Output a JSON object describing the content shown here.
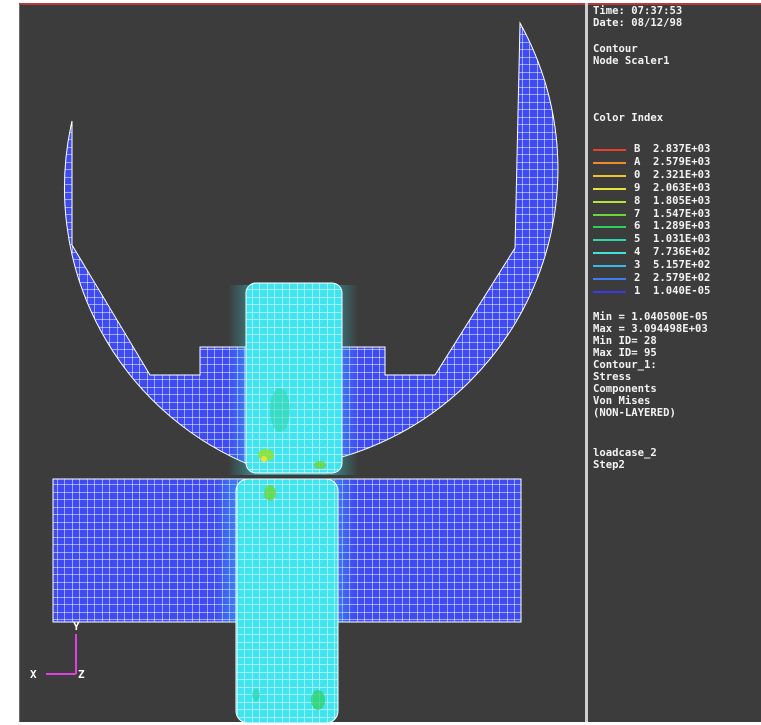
{
  "header": {
    "time": "Time: 07:37:53",
    "date": "Date: 08/12/98"
  },
  "plot": {
    "type_line1": "Contour",
    "type_line2": "Node Scaler1",
    "legend_title": "Color Index",
    "legend": [
      {
        "index": "B",
        "value": "2.837E+03",
        "color": "#e8402a"
      },
      {
        "index": "A",
        "value": "2.579E+03",
        "color": "#f08a2a"
      },
      {
        "index": "0",
        "value": "2.321E+03",
        "color": "#f0c32a"
      },
      {
        "index": "9",
        "value": "2.063E+03",
        "color": "#e8e23a"
      },
      {
        "index": "8",
        "value": "1.805E+03",
        "color": "#b8e23a"
      },
      {
        "index": "7",
        "value": "1.547E+03",
        "color": "#6fd63a"
      },
      {
        "index": "6",
        "value": "1.289E+03",
        "color": "#2fcf5a"
      },
      {
        "index": "5",
        "value": "1.031E+03",
        "color": "#2fd6a6"
      },
      {
        "index": "4",
        "value": "7.736E+02",
        "color": "#3fe2d8"
      },
      {
        "index": "3",
        "value": "5.157E+02",
        "color": "#39b8ee"
      },
      {
        "index": "2",
        "value": "2.579E+02",
        "color": "#3f7cf2"
      },
      {
        "index": "1",
        "value": "1.040E-05",
        "color": "#3a3ae8"
      }
    ],
    "min": "Min = 1.040500E-05",
    "max": "Max = 3.094498E+03",
    "min_id": "Min ID= 28",
    "max_id": "Max ID= 95",
    "contour_lines": [
      "Contour_1:",
      "Stress",
      "Components",
      "Von Mises",
      "(NON-LAYERED)"
    ],
    "loadcase_lines": [
      "loadcase_2",
      "Step2"
    ]
  },
  "axes": {
    "x_label": "X",
    "y_label": "Y",
    "z_label": "Z"
  },
  "colors": {
    "background": "#3c3c3c",
    "mesh_blue": "#3f4bf2",
    "mesh_cyan": "#3fe4f0",
    "grid_line": "#ffffff",
    "triad": "#e040e0"
  }
}
